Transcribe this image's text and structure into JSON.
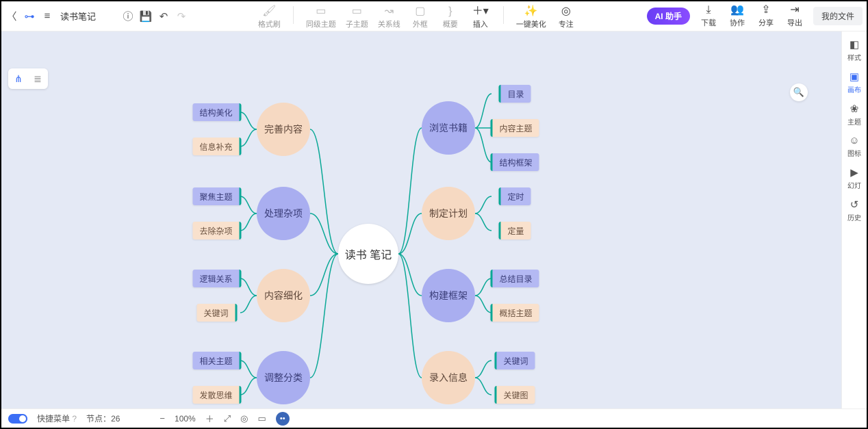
{
  "title": "读书笔记",
  "toolbar": {
    "format_painter": "格式刷",
    "sibling": "同级主题",
    "child": "子主题",
    "relation": "关系线",
    "frame": "外框",
    "summary": "概要",
    "insert": "插入",
    "beautify": "一键美化",
    "focus": "专注",
    "ai": "AI 助手",
    "download": "下载",
    "collab": "协作",
    "share": "分享",
    "export": "导出",
    "myfiles": "我的文件"
  },
  "sidebar": [
    "样式",
    "画布",
    "主题",
    "图标",
    "幻灯",
    "历史"
  ],
  "status": {
    "quick_label": "快捷菜单",
    "nodes_label": "节点：",
    "nodes_count": 26,
    "zoom": "100%"
  },
  "mindmap": {
    "center": "读书\n笔记",
    "left": [
      {
        "id": "l1",
        "label": "完善内容",
        "color": "pe",
        "children": [
          {
            "id": "l1a",
            "label": "结构美化",
            "color": "b"
          },
          {
            "id": "l1b",
            "label": "信息补充",
            "color": "o"
          }
        ]
      },
      {
        "id": "l2",
        "label": "处理杂项",
        "color": "vi",
        "children": [
          {
            "id": "l2a",
            "label": "聚焦主题",
            "color": "b"
          },
          {
            "id": "l2b",
            "label": "去除杂项",
            "color": "o"
          }
        ]
      },
      {
        "id": "l3",
        "label": "内容细化",
        "color": "pe",
        "children": [
          {
            "id": "l3a",
            "label": "逻辑关系",
            "color": "b"
          },
          {
            "id": "l3b",
            "label": "关键词",
            "color": "o"
          }
        ]
      },
      {
        "id": "l4",
        "label": "调整分类",
        "color": "vi",
        "children": [
          {
            "id": "l4a",
            "label": "相关主题",
            "color": "b"
          },
          {
            "id": "l4b",
            "label": "发散思维",
            "color": "o"
          }
        ]
      }
    ],
    "right": [
      {
        "id": "r1",
        "label": "浏览书籍",
        "color": "vi",
        "children": [
          {
            "id": "r1a",
            "label": "目录",
            "color": "b"
          },
          {
            "id": "r1b",
            "label": "内容主题",
            "color": "o"
          },
          {
            "id": "r1c",
            "label": "结构框架",
            "color": "b"
          }
        ]
      },
      {
        "id": "r2",
        "label": "制定计划",
        "color": "pe",
        "children": [
          {
            "id": "r2a",
            "label": "定时",
            "color": "b"
          },
          {
            "id": "r2b",
            "label": "定量",
            "color": "o"
          }
        ]
      },
      {
        "id": "r3",
        "label": "构建框架",
        "color": "vi",
        "children": [
          {
            "id": "r3a",
            "label": "总结目录",
            "color": "b"
          },
          {
            "id": "r3b",
            "label": "概括主题",
            "color": "o"
          }
        ]
      },
      {
        "id": "r4",
        "label": "录入信息",
        "color": "pe",
        "children": [
          {
            "id": "r4a",
            "label": "关键词",
            "color": "b"
          },
          {
            "id": "r4b",
            "label": "关键图",
            "color": "o"
          }
        ]
      }
    ]
  },
  "chart_data": {
    "type": "mindmap",
    "root": "读书笔记",
    "branches": {
      "left": [
        {
          "node": "完善内容",
          "children": [
            "结构美化",
            "信息补充"
          ]
        },
        {
          "node": "处理杂项",
          "children": [
            "聚焦主题",
            "去除杂项"
          ]
        },
        {
          "node": "内容细化",
          "children": [
            "逻辑关系",
            "关键词"
          ]
        },
        {
          "node": "调整分类",
          "children": [
            "相关主题",
            "发散思维"
          ]
        }
      ],
      "right": [
        {
          "node": "浏览书籍",
          "children": [
            "目录",
            "内容主题",
            "结构框架"
          ]
        },
        {
          "node": "制定计划",
          "children": [
            "定时",
            "定量"
          ]
        },
        {
          "node": "构建框架",
          "children": [
            "总结目录",
            "概括主题"
          ]
        },
        {
          "node": "录入信息",
          "children": [
            "关键词",
            "关键图"
          ]
        }
      ]
    }
  }
}
